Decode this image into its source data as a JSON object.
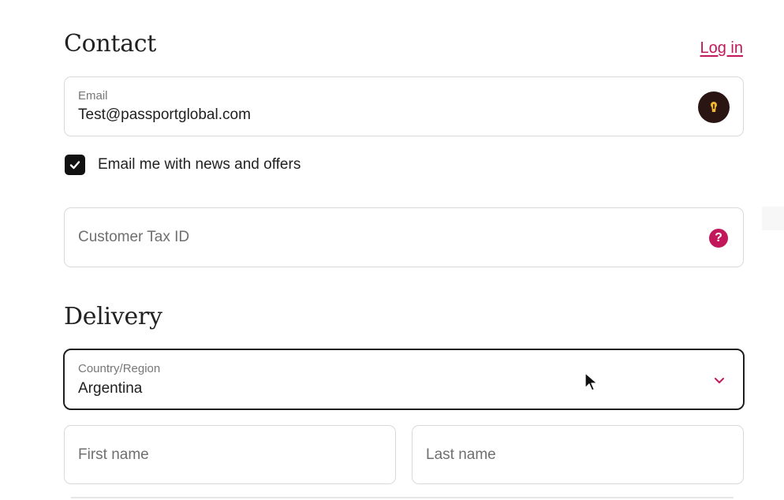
{
  "contact": {
    "title": "Contact",
    "login_link": "Log in",
    "email_label": "Email",
    "email_value": "Test@passportglobal.com",
    "newsletter_label": "Email me with news and offers",
    "newsletter_checked": true,
    "tax_placeholder": "Customer Tax ID",
    "help_icon": "question-icon"
  },
  "delivery": {
    "title": "Delivery",
    "country_label": "Country/Region",
    "country_value": "Argentina",
    "first_name_placeholder": "First name",
    "last_name_placeholder": "Last name"
  },
  "colors": {
    "accent": "#c2185b",
    "keyhole_bg": "#2a1512",
    "keyhole_fg": "#f2b630",
    "checkbox_bg": "#111111"
  }
}
